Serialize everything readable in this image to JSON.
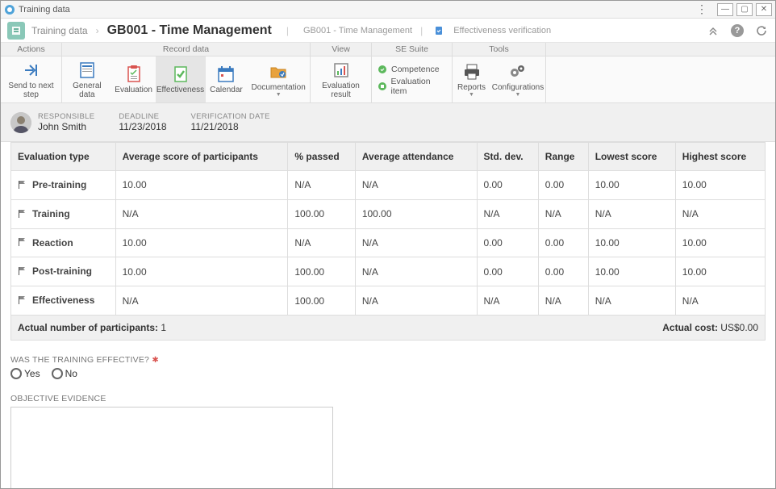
{
  "window": {
    "title": "Training data"
  },
  "breadcrumb": {
    "root": "Training data",
    "main": "GB001 - Time Management",
    "sub": "GB001 - Time Management",
    "verification": "Effectiveness verification"
  },
  "ribbon_groups": {
    "actions": "Actions",
    "record": "Record data",
    "view": "View",
    "suite": "SE Suite",
    "tools": "Tools"
  },
  "ribbon": {
    "send": "Send to next step",
    "general": "General data",
    "evaluation": "Evaluation",
    "effectiveness": "Effectiveness",
    "calendar": "Calendar",
    "documentation": "Documentation",
    "result": "Evaluation result",
    "competence": "Competence",
    "evalitem": "Evaluation item",
    "reports": "Reports",
    "configurations": "Configurations"
  },
  "meta": {
    "responsible_label": "RESPONSIBLE",
    "responsible_value": "John Smith",
    "deadline_label": "DEADLINE",
    "deadline_value": "11/23/2018",
    "verification_label": "VERIFICATION DATE",
    "verification_value": "11/21/2018"
  },
  "table": {
    "headers": [
      "Evaluation type",
      "Average score of participants",
      "% passed",
      "Average attendance",
      "Std. dev.",
      "Range",
      "Lowest score",
      "Highest score"
    ],
    "rows": [
      {
        "type": "Pre-training",
        "cells": [
          "10.00",
          "N/A",
          "N/A",
          "0.00",
          "0.00",
          "10.00",
          "10.00"
        ]
      },
      {
        "type": "Training",
        "cells": [
          "N/A",
          "100.00",
          "100.00",
          "N/A",
          "N/A",
          "N/A",
          "N/A"
        ]
      },
      {
        "type": "Reaction",
        "cells": [
          "10.00",
          "N/A",
          "N/A",
          "0.00",
          "0.00",
          "10.00",
          "10.00"
        ]
      },
      {
        "type": "Post-training",
        "cells": [
          "10.00",
          "100.00",
          "N/A",
          "0.00",
          "0.00",
          "10.00",
          "10.00"
        ]
      },
      {
        "type": "Effectiveness",
        "cells": [
          "N/A",
          "100.00",
          "N/A",
          "N/A",
          "N/A",
          "N/A",
          "N/A"
        ]
      }
    ]
  },
  "footer": {
    "participants_label": "Actual number of participants:",
    "participants_value": "1",
    "cost_label": "Actual cost:",
    "cost_value": "US$0.00"
  },
  "question": {
    "label": "WAS THE TRAINING EFFECTIVE?",
    "yes": "Yes",
    "no": "No"
  },
  "evidence": {
    "label": "OBJECTIVE EVIDENCE",
    "value": ""
  }
}
